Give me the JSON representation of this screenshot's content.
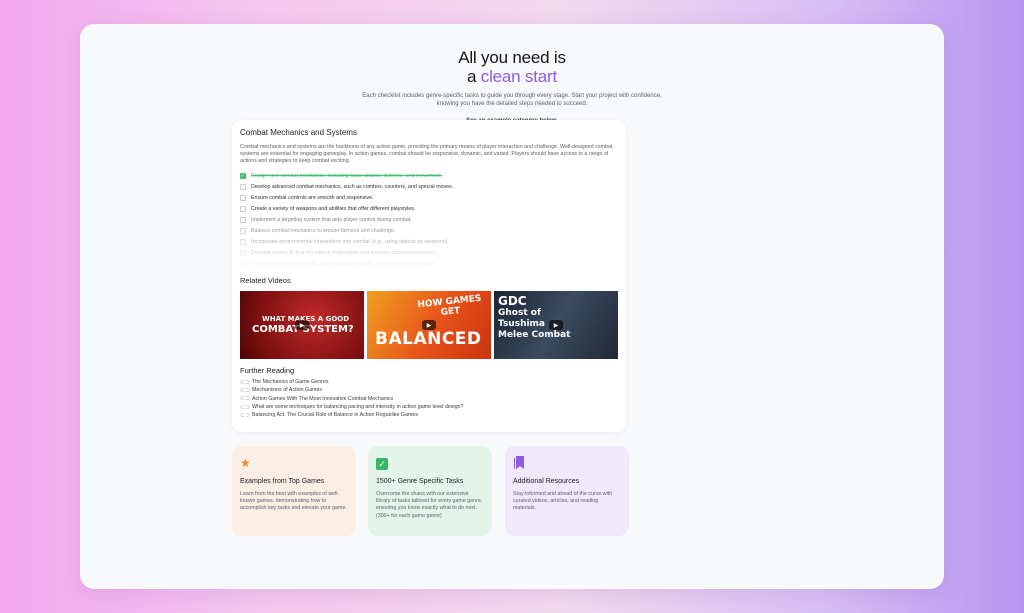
{
  "hero": {
    "title_line1": "All you need is",
    "title_prefix": "a ",
    "title_accent": "clean start",
    "subtitle": "Each checklist includes genre-specific tasks to guide you through every stage. Start your project with confidence, knowing you have the detailed steps needed to succeed.",
    "hint": "See an example category below."
  },
  "category": {
    "title": "Combat Mechanics and Systems",
    "description": "Combat mechanics and systems are the backbone of any action game, providing the primary means of player interaction and challenge. Well-designed combat systems are essential for engaging gameplay. In action games, combat should be responsive, dynamic, and varied. Players should have access to a range of actions and strategies to keep combat exciting.",
    "tasks": [
      {
        "label": "Design core combat mechanics, including basic attacks, defense, and movement.",
        "done": true
      },
      {
        "label": "Develop advanced combat mechanics, such as combos, counters, and special moves.",
        "done": false
      },
      {
        "label": "Ensure combat controls are smooth and responsive.",
        "done": false
      },
      {
        "label": "Create a variety of weapons and abilities that offer different playstyles.",
        "done": false
      },
      {
        "label": "Implement a targeting system that aids player control during combat.",
        "done": false
      },
      {
        "label": "Balance combat mechanics to ensure fairness and challenge.",
        "done": false
      },
      {
        "label": "Incorporate environmental interactions into combat (e.g., using objects as weapons).",
        "done": false
      },
      {
        "label": "Develop enemy AI that provides a challenging and dynamic combat experience.",
        "done": false
      },
      {
        "label": "Ensure that visual and audio feedback enhances the impact of combat actions.",
        "done": false
      }
    ],
    "related_videos_title": "Related Videos",
    "videos": [
      {
        "text_top": "WHAT MAKES A GOOD",
        "text_main": "COMBAT SYSTEM?"
      },
      {
        "text_top": "HOW GAMES GET",
        "text_main": "BALANCED"
      },
      {
        "text_top": "GDC",
        "text_main": "Ghost of Tsushima Melee Combat"
      }
    ],
    "further_reading_title": "Further Reading",
    "links": [
      "The Mechanics of Game Genres",
      "Mechanisms of Action Games",
      "Action Games With The Most Innovative Combat Mechanics",
      "What are some techniques for balancing pacing and intensity in action game level design?",
      "Balancing Act: The Crucial Role of Balance in Action Roguelike Games"
    ]
  },
  "features": [
    {
      "icon": "star-icon",
      "title": "Examples from Top Games",
      "text": "Learn from the best with examples of well-known games, demonstrating how to accomplish key tasks and elevate your game."
    },
    {
      "icon": "checkbox-icon",
      "title": "1500+ Genre Specific Tasks",
      "text": "Overcome the chaos with our extensive library of tasks tailored for every game genre, ensuring you know exactly what to do next.",
      "note": "(300+ for each game genre)"
    },
    {
      "icon": "bookmarks-icon",
      "title": "Additional Resources",
      "text": "Stay informed and ahead of the curve with curated videos, articles, and reading materials."
    }
  ],
  "colors": {
    "accent": "#8f5be0",
    "done": "#3fc06e",
    "star": "#f08c1a"
  }
}
